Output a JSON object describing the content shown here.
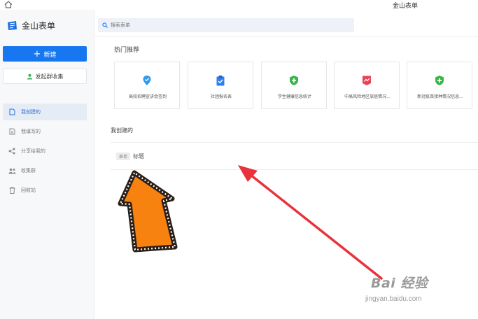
{
  "window": {
    "title": "金山表单"
  },
  "sidebar": {
    "app_name": "金山表单",
    "new_label": "新建",
    "group_collect_label": "发起群收集",
    "items": [
      {
        "label": "我创建的",
        "icon": "file-icon",
        "active": true
      },
      {
        "label": "我填写的",
        "icon": "edit-file-icon",
        "active": false
      },
      {
        "label": "分享给我的",
        "icon": "share-icon",
        "active": false
      },
      {
        "label": "收集群",
        "icon": "group-icon",
        "active": false
      },
      {
        "label": "回收站",
        "icon": "trash-icon",
        "active": false
      }
    ]
  },
  "search": {
    "placeholder": "搜索表单"
  },
  "hot": {
    "title": "热门推荐",
    "cards": [
      {
        "label": "高校招聘宣讲会签到",
        "icon": "location-pin-icon",
        "color": "#2d9cf0"
      },
      {
        "label": "社团报名表",
        "icon": "clipboard-check-icon",
        "color": "#2d7ff0"
      },
      {
        "label": "学生健康信息统计",
        "icon": "shield-plus-icon",
        "color": "#39b54a"
      },
      {
        "label": "中高风险地区旅居情况...",
        "icon": "trend-flag-icon",
        "color": "#e8425a"
      },
      {
        "label": "新冠疫苗接种情况信息...",
        "icon": "shield-plus-icon",
        "color": "#39b54a"
      }
    ]
  },
  "mine": {
    "title": "我创建的",
    "docs": [
      {
        "tag": "表单",
        "title": "标题"
      }
    ]
  },
  "watermark": {
    "brand": "Bai 经验",
    "url": "jingyan.baidu.com"
  },
  "colors": {
    "accent": "#1677f0",
    "arrow_red": "#e8323c",
    "arrow_orange": "#f7820f"
  }
}
